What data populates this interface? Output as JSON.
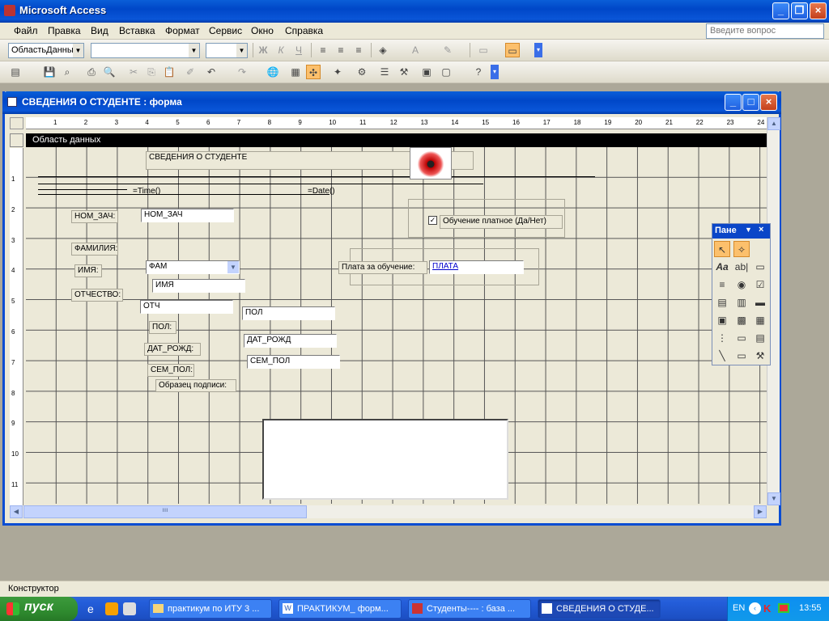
{
  "app": {
    "title": "Microsoft Access"
  },
  "menu": [
    "Файл",
    "Правка",
    "Вид",
    "Вставка",
    "Формат",
    "Сервис",
    "Окно",
    "Справка"
  ],
  "ask_placeholder": "Введите вопрос",
  "toolbar": {
    "object_combo": "ОбластьДанны",
    "font_combo": "",
    "size_combo": "",
    "bold": "Ж",
    "italic": "К",
    "underline": "Ч"
  },
  "form_window": {
    "title": "СВЕДЕНИЯ О СТУДЕНТЕ : форма",
    "section": "Область данных"
  },
  "ruler_h": [
    "1",
    "2",
    "3",
    "4",
    "5",
    "6",
    "7",
    "8",
    "9",
    "10",
    "11",
    "12",
    "13",
    "14",
    "15",
    "16",
    "17",
    "18",
    "19",
    "20",
    "21",
    "22",
    "23",
    "24"
  ],
  "ruler_v": [
    "1",
    "2",
    "3",
    "4",
    "5",
    "6",
    "7",
    "8",
    "9",
    "10",
    "11"
  ],
  "form": {
    "header_label": "СВЕДЕНИЯ О СТУДЕНТЕ",
    "time_field": "=Time()",
    "date_field": "=Date()",
    "nom_zach_label": "НОМ_ЗАЧ:",
    "nom_zach_field": "НОМ_ЗАЧ",
    "checkbox_label": "Обучение платное (Да/Нет)",
    "familiya_label": "ФАМИЛИЯ:",
    "fam_combo": "ФАМ",
    "imya_label": "ИМЯ:",
    "imya_field": "ИМЯ",
    "plata_label": "Плата за обучение:",
    "plata_field": "ПЛАТА",
    "otchestvo_label": "ОТЧЕСТВО:",
    "otch_field": "ОТЧ",
    "pol_field": "ПОЛ",
    "pol_label": "ПОЛ:",
    "dat_rozhd_label": "ДАТ_РОЖД:",
    "dat_rozhd_field": "ДАТ_РОЖД",
    "sem_pol_label": "СЕМ_ПОЛ:",
    "sem_pol_field": "СЕМ_ПОЛ",
    "signature_label": "Образец подписи:"
  },
  "toolbox": {
    "title": "Пане"
  },
  "status": "Конструктор",
  "taskbar": {
    "start": "пуск",
    "tasks": [
      "практикум по ИТУ 3 ...",
      "ПРАКТИКУМ_ форм...",
      "Студенты---- : база ...",
      "СВЕДЕНИЯ О СТУДЕ..."
    ],
    "lang": "EN",
    "clock": "13:55"
  }
}
